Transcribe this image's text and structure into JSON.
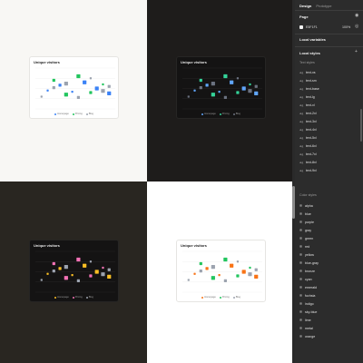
{
  "charts": {
    "title": "Unique visitors",
    "legend": [
      "Homepage",
      "Pricing",
      "Blog"
    ],
    "themes": {
      "tl": {
        "series_colors": [
          "#3b82f6",
          "#22c55e",
          "#9ca3af"
        ]
      },
      "tr": {
        "series_colors": [
          "#60a5fa",
          "#34d399",
          "#6b7280"
        ]
      },
      "bl": {
        "series_colors": [
          "#fbbf24",
          "#f472b6",
          "#9ca3af"
        ]
      },
      "br": {
        "series_colors": [
          "#f97316",
          "#22c55e",
          "#9ca3af"
        ]
      }
    }
  },
  "chart_data": [
    {
      "type": "scatter",
      "title": "Unique visitors",
      "series": [
        {
          "name": "Homepage",
          "values": [
            [
              2,
              45
            ],
            [
              4,
              58
            ],
            [
              6,
              42
            ],
            [
              8,
              65
            ],
            [
              10,
              50
            ],
            [
              12,
              38
            ]
          ]
        },
        {
          "name": "Pricing",
          "values": [
            [
              3,
              70
            ],
            [
              5,
              35
            ],
            [
              7,
              80
            ],
            [
              9,
              40
            ],
            [
              11,
              60
            ]
          ]
        },
        {
          "name": "Blog",
          "values": [
            [
              1,
              30
            ],
            [
              3,
              52
            ],
            [
              5,
              62
            ],
            [
              7,
              28
            ],
            [
              9,
              75
            ],
            [
              11,
              44
            ],
            [
              12,
              55
            ]
          ]
        }
      ],
      "xlim": [
        0,
        13
      ],
      "ylim": [
        0,
        100
      ],
      "grid": true,
      "legend_position": "bottom"
    }
  ],
  "panel": {
    "tabs": [
      "Design",
      "Prototype"
    ],
    "page": {
      "title": "Page",
      "color": "E5F1F1",
      "opacity": "100%"
    },
    "local_variables": "Local variables",
    "local_styles": "Local styles",
    "text_styles": {
      "label": "Text styles",
      "items": [
        "text-xs",
        "text-sm",
        "text-base",
        "text-lg",
        "text-xl",
        "text-2xl",
        "text-3xl",
        "text-4xl",
        "text-5xl",
        "text-6xl",
        "text-7xl",
        "text-8xl",
        "text-9xl"
      ]
    },
    "color_styles": {
      "label": "Color styles",
      "items": [
        "alpha",
        "blue",
        "purple",
        "gray",
        "green",
        "red",
        "yellow",
        "blue-gray",
        "bronze",
        "cyan",
        "emerald",
        "fuchsia",
        "indigo",
        "sky-blue",
        "lime",
        "metal",
        "orange"
      ]
    }
  }
}
